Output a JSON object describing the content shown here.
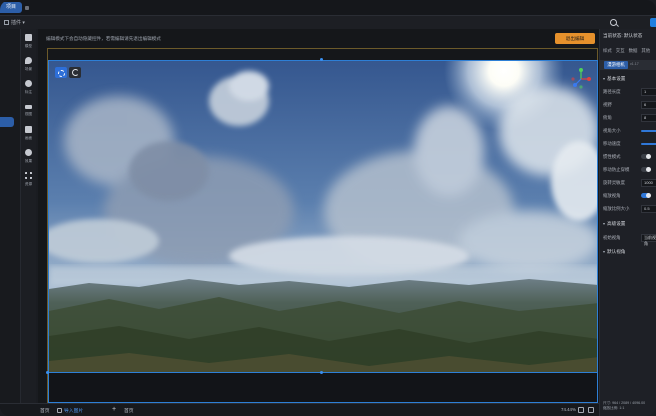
{
  "titlebar": {
    "active_tab": "项目"
  },
  "toolbar": {
    "menu_label": "插件"
  },
  "tools": [
    {
      "icon": "file-icon",
      "label": "模型"
    },
    {
      "icon": "location-pin-icon",
      "label": "场景"
    },
    {
      "icon": "pin-icon",
      "label": "标注"
    },
    {
      "icon": "eye-icon",
      "label": "视图"
    },
    {
      "icon": "image-icon",
      "label": "画面"
    },
    {
      "icon": "settings-icon",
      "label": "效果"
    },
    {
      "icon": "grid-icon",
      "label": "资源"
    }
  ],
  "stage": {
    "hint": "编辑模式下会自动隐藏控件，若需编辑请先退出编辑模式",
    "exit_button": "退出编辑"
  },
  "panel": {
    "header": "当前状态: 默认状态",
    "tabs": [
      "样式",
      "交互",
      "数据",
      "其他"
    ],
    "component": {
      "name": "漫游相机",
      "version": "v1.17"
    },
    "section_basic": "基本设置",
    "rows": [
      {
        "label": "路径长度",
        "kind": "input",
        "value": "1"
      },
      {
        "label": "视野",
        "kind": "input",
        "value": "6"
      },
      {
        "label": "俯角",
        "kind": "input",
        "value": "8"
      },
      {
        "label": "视角大小",
        "kind": "slider"
      },
      {
        "label": "移动速度",
        "kind": "slider"
      },
      {
        "label": "惯性模式",
        "kind": "toggle"
      },
      {
        "label": "移动防止穿模",
        "kind": "toggle"
      },
      {
        "label": "旋转灵敏度",
        "kind": "input",
        "value": "1000"
      },
      {
        "label": "缩放视角",
        "kind": "toggle-on"
      },
      {
        "label": "缩放比例大小",
        "kind": "input",
        "value": "0.5"
      }
    ],
    "section_adv": "高级设置",
    "init_label": "初始视角",
    "init_value": "当前视角",
    "section_group": "默认视角",
    "footer_line1": "尺寸: 964 / 2089 / 4096.00",
    "footer_line2": "缩放比例: 1:1"
  },
  "status": {
    "page": "首页",
    "layer": "导入图片",
    "home": "首页",
    "zoom": "74.44%"
  }
}
